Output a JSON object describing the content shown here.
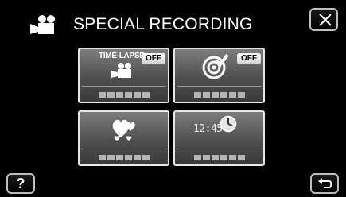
{
  "header": {
    "title": "SPECIAL RECORDING",
    "mode_icon": "movie-camera-icon",
    "close_icon": "close-icon"
  },
  "tiles": [
    {
      "name": "time-lapse",
      "icon": "time-lapse-camera-icon",
      "icon_text": "TIME-LAPSE",
      "status": "OFF"
    },
    {
      "name": "auto-rec",
      "icon": "target-check-icon",
      "status": "OFF"
    },
    {
      "name": "effect-animation",
      "icon": "hearts-icon"
    },
    {
      "name": "date-time-recording",
      "icon": "clock-icon",
      "icon_text": "12:45"
    }
  ],
  "footer": {
    "help_label": "?",
    "back_icon": "return-arrow-icon"
  },
  "colors": {
    "background": "#000000",
    "tile_top": "#7d7d7d",
    "tile_bottom": "#3a3a3a",
    "border": "#e6e6e6"
  }
}
